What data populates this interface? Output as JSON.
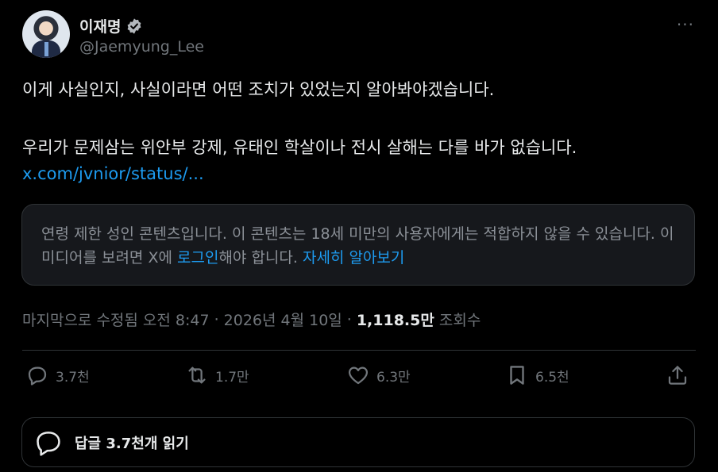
{
  "author": {
    "name": "이재명",
    "handle": "@Jaemyung_Lee",
    "more": "···"
  },
  "tweet": {
    "line1": "이게 사실인지, 사실이라면 어떤 조치가 있었는지 알아봐야겠습니다.",
    "line2": "우리가 문제삼는 위안부 강제, 유태인 학살이나 전시 살해는 다를 바가 없습니다.",
    "link": "x.com/jvnior/status/..."
  },
  "warning": {
    "text_part1": "연령 제한 성인 콘텐츠입니다. 이 콘텐츠는 18세 미만의 사용자에게는 적합하지 않을 수 있습니다. 이 미디어를 보려면 X에 ",
    "login_link": "로그인",
    "text_part2": "해야 합니다. ",
    "learn_more": "자세히 알아보기"
  },
  "meta": {
    "edited_time": "마지막으로 수정됨 오전 8:47",
    "sep1": "·",
    "date": "2026년 4월 10일",
    "sep2": "·",
    "views_count": "1,118.5만",
    "views_label": "조회수"
  },
  "actions": {
    "replies": "3.7천",
    "reposts": "1.7만",
    "likes": "6.3만",
    "bookmarks": "6.5천"
  },
  "replies_bar": {
    "label": "답글 3.7천개 읽기"
  },
  "colors": {
    "background": "#000000",
    "text": "#e7e9ea",
    "muted": "#71767b",
    "accent": "#1d9bf0"
  }
}
